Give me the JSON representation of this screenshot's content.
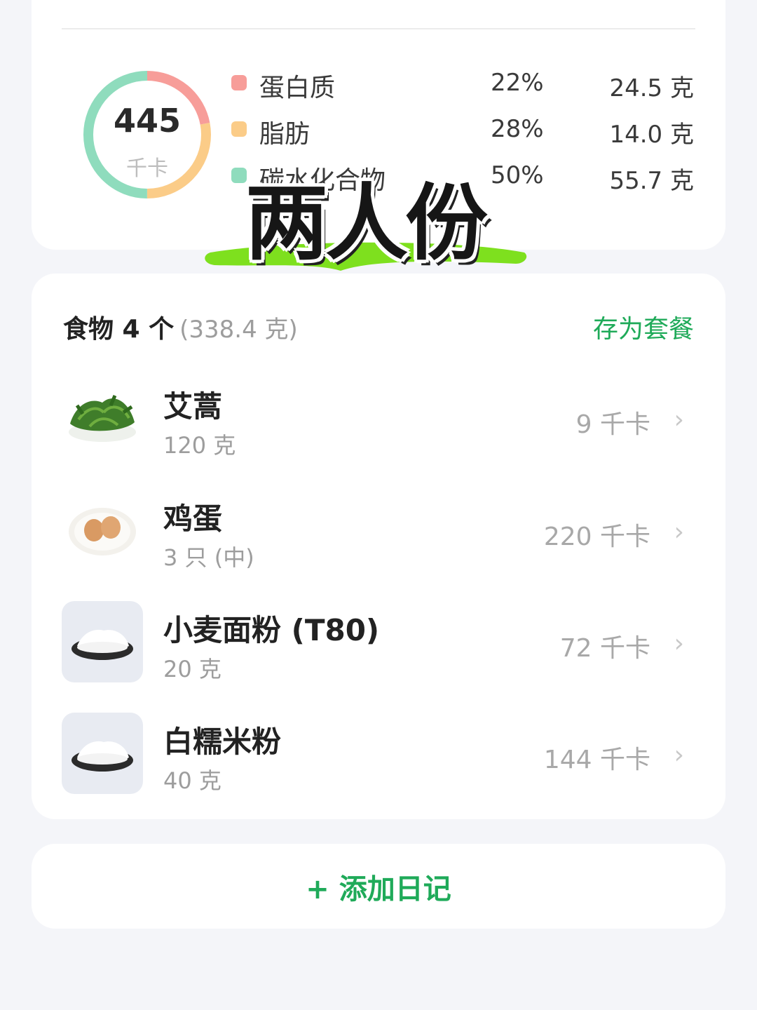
{
  "summary": {
    "kcal_value": "445",
    "kcal_unit": "千卡",
    "macros": [
      {
        "name": "蛋白质",
        "percent": "22%",
        "grams": "24.5 克",
        "color": "#f79d99",
        "share": 0.22
      },
      {
        "name": "脂肪",
        "percent": "28%",
        "grams": "14.0 克",
        "color": "#fbcc88",
        "share": 0.28
      },
      {
        "name": "碳水化合物",
        "percent": "50%",
        "grams": "55.7 克",
        "color": "#8fdcbd",
        "share": 0.5
      }
    ]
  },
  "overlay": {
    "title": "两人份",
    "swash_color": "#7ee01e"
  },
  "foods": {
    "count_label": "食物 4 个",
    "total_label": "(338.4 克)",
    "save_label": "存为套餐",
    "items": [
      {
        "name": "艾蒿",
        "amount": "120 克",
        "kcal": "9 千卡",
        "icon": "mugwort-image"
      },
      {
        "name": "鸡蛋",
        "amount": "3 只 (中)",
        "kcal": "220 千卡",
        "icon": "egg-image"
      },
      {
        "name": "小麦面粉 (T80)",
        "amount": "20 克",
        "kcal": "72 千卡",
        "icon": "wheat-flour-image"
      },
      {
        "name": "白糯米粉",
        "amount": "40 克",
        "kcal": "144 千卡",
        "icon": "glutinous-rice-flour-image"
      }
    ]
  },
  "add_diary_label": "+ 添加日记",
  "accent_color": "#1faa59"
}
